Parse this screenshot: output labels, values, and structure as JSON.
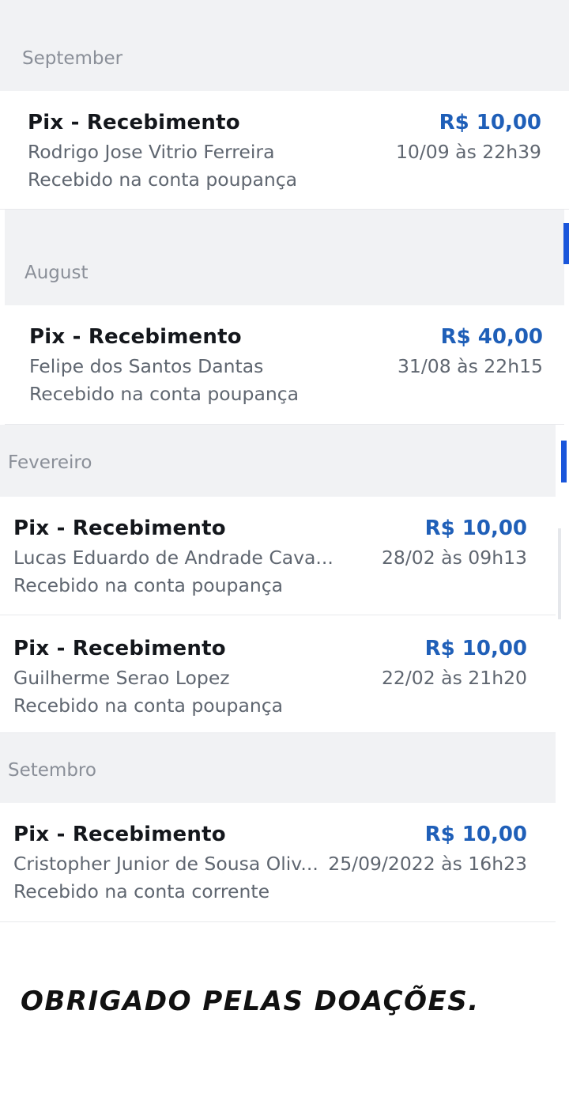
{
  "sections": [
    {
      "month": "September",
      "transactions": [
        {
          "title": "Pix - Recebimento",
          "name": "Rodrigo Jose Vitrio Ferreira",
          "account": "Recebido na conta poupança",
          "amount": "R$ 10,00",
          "date": "10/09 às 22h39"
        }
      ]
    },
    {
      "month": "August",
      "transactions": [
        {
          "title": "Pix - Recebimento",
          "name": "Felipe dos Santos Dantas",
          "account": "Recebido na conta poupança",
          "amount": "R$ 40,00",
          "date": "31/08 às 22h15"
        }
      ]
    },
    {
      "month": "Fevereiro",
      "transactions": [
        {
          "title": "Pix - Recebimento",
          "name": "Lucas Eduardo de Andrade Cava...",
          "account": "Recebido na conta poupança",
          "amount": "R$ 10,00",
          "date": "28/02 às 09h13"
        },
        {
          "title": "Pix - Recebimento",
          "name": "Guilherme Serao Lopez",
          "account": "Recebido na conta poupança",
          "amount": "R$ 10,00",
          "date": "22/02 às 21h20"
        }
      ]
    },
    {
      "month": "Setembro",
      "transactions": [
        {
          "title": "Pix - Recebimento",
          "name": "Cristopher Junior de Sousa Oliv...",
          "account": "Recebido na conta corrente",
          "amount": "R$ 10,00",
          "date": "25/09/2022 às 16h23"
        }
      ]
    }
  ],
  "caption": "Obrigado pelas doações.",
  "colors": {
    "amount": "#1f5fb8",
    "section_header_bg": "#f1f2f4",
    "scroll_accent": "#1a56db"
  }
}
